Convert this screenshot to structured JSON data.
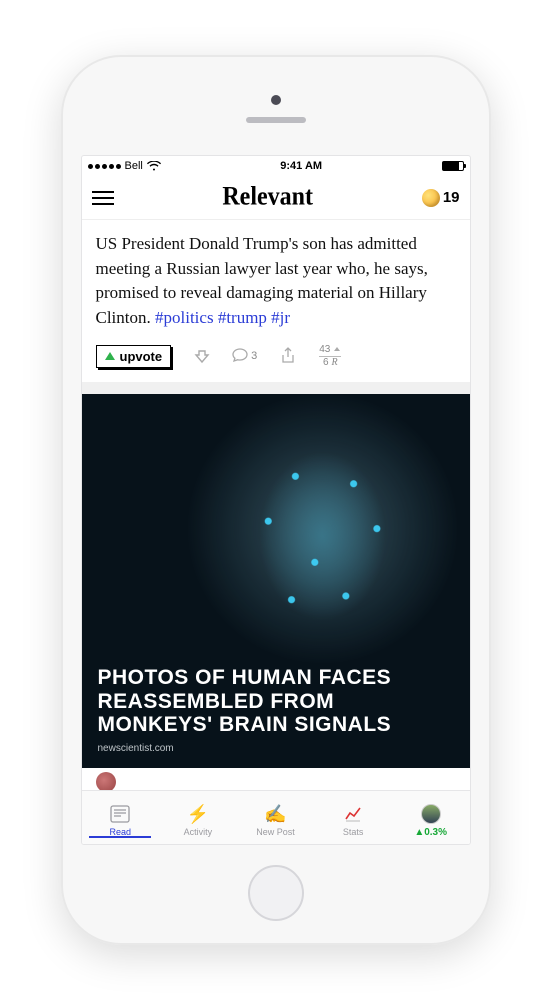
{
  "status": {
    "carrier": "Bell",
    "time": "9:41 AM"
  },
  "header": {
    "logo": "Relevant",
    "coin_count": "19"
  },
  "post": {
    "text": "US President Donald Trump's son has admitted meeting a Russian lawyer last year who, he says, promised to reveal damaging material on Hillary Clinton.",
    "tags": "#politics #trump #jr"
  },
  "actions": {
    "upvote_label": "upvote",
    "comment_count": "3",
    "score_top": "43",
    "score_bottom": "6"
  },
  "image_post": {
    "headline": "PHOTOS OF HUMAN FACES REASSEMBLED FROM MONKEYS' BRAIN SIGNALS",
    "source": "newscientist.com"
  },
  "tabs": {
    "read": "Read",
    "activity": "Activity",
    "new_post": "New Post",
    "stats": "Stats",
    "profit": "▲0.3%"
  }
}
